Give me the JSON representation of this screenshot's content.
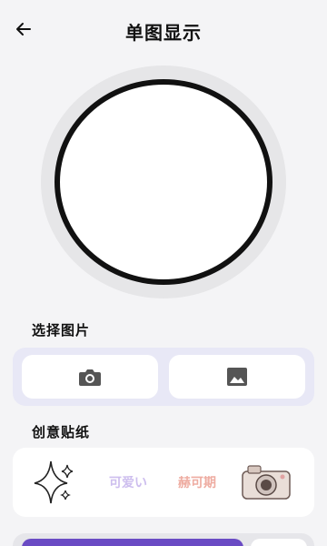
{
  "header": {
    "title": "单图显示",
    "back_icon": "arrow-left-icon"
  },
  "section_select": {
    "label": "选择图片",
    "buttons": [
      {
        "icon": "camera-icon"
      },
      {
        "icon": "image-icon"
      }
    ]
  },
  "section_stickers": {
    "label": "创意贴纸",
    "stickers": [
      {
        "icon": "sparkle-icon",
        "text": ""
      },
      {
        "icon": "text-sticker",
        "text": "可爱い"
      },
      {
        "icon": "text-sticker",
        "text": "赫可期"
      },
      {
        "icon": "camera-sticker-icon",
        "text": ""
      }
    ]
  },
  "colors": {
    "accent": "#6a4bc4",
    "picker_panel": "#e8e8f6",
    "background": "#f4f4f6"
  }
}
